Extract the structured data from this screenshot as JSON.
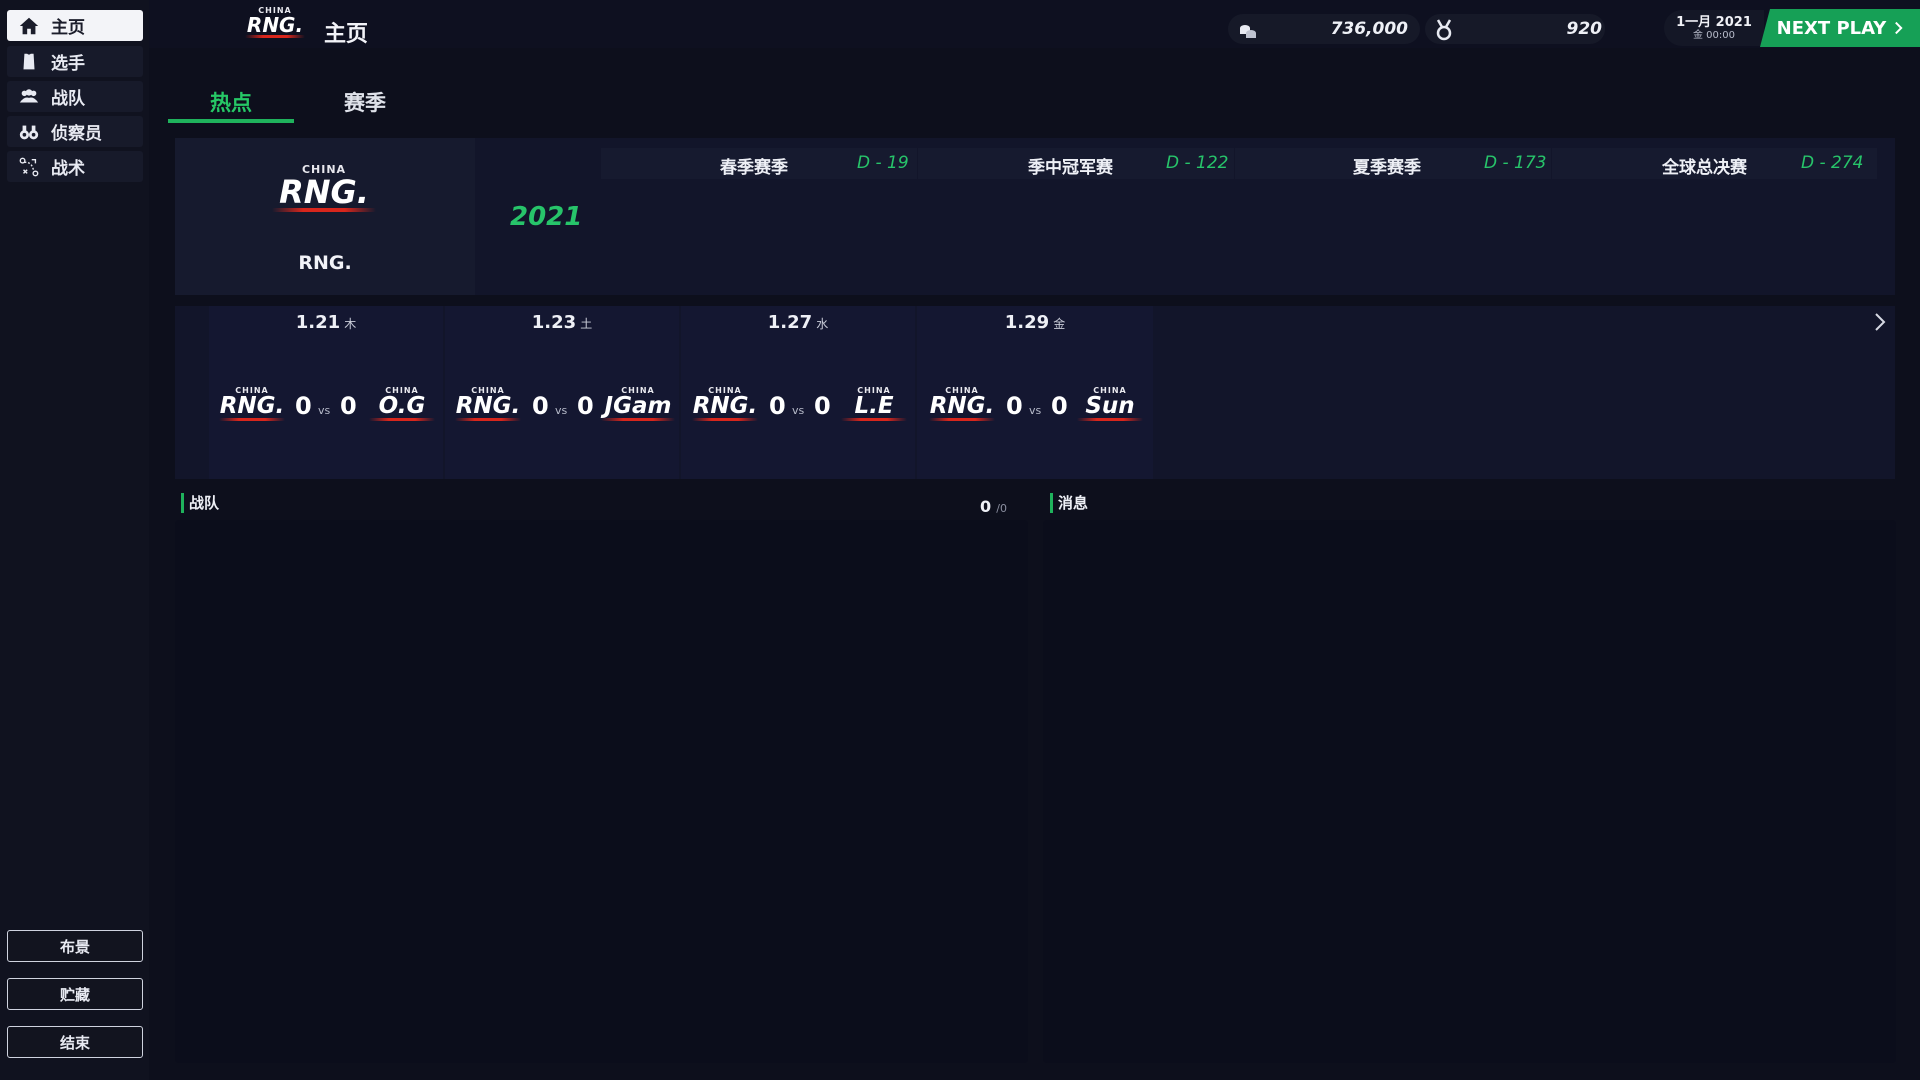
{
  "sidebar": {
    "items": [
      {
        "label": "主页",
        "icon": "home-icon",
        "active": true
      },
      {
        "label": "选手",
        "icon": "player-icon",
        "active": false
      },
      {
        "label": "战队",
        "icon": "team-icon",
        "active": false
      },
      {
        "label": "侦察员",
        "icon": "binoculars-icon",
        "active": false
      },
      {
        "label": "战术",
        "icon": "tactics-icon",
        "active": false
      }
    ],
    "bottom_buttons": [
      "布景",
      "贮藏",
      "结束"
    ]
  },
  "header": {
    "logo_small_text": "CHINA",
    "logo_team": "RNG.",
    "title": "主页",
    "money": "736,000",
    "points": "920",
    "date_main": "1一月 2021",
    "date_sub": "金 00:00",
    "next_play": "NEXT PLAY"
  },
  "tabs": [
    {
      "label": "热点",
      "active": true
    },
    {
      "label": "赛季",
      "active": false
    }
  ],
  "team_card": {
    "logo_small": "CHINA",
    "logo_name": "RNG.",
    "name": "RNG."
  },
  "season": {
    "year": "2021",
    "events": [
      {
        "name": "春季赛季",
        "countdown": "D - 19"
      },
      {
        "name": "季中冠军赛",
        "countdown": "D - 122"
      },
      {
        "name": "夏季赛季",
        "countdown": "D - 173"
      },
      {
        "name": "全球总决赛",
        "countdown": "D - 274"
      }
    ]
  },
  "matches": [
    {
      "date": "1.21",
      "day": "木",
      "home": "RNG.",
      "away": "O.G",
      "home_score": "0",
      "away_score": "0",
      "vs": "vs",
      "home_china": "CHINA",
      "away_china": "CHINA"
    },
    {
      "date": "1.23",
      "day": "土",
      "home": "RNG.",
      "away": "JGam",
      "home_score": "0",
      "away_score": "0",
      "vs": "vs",
      "home_china": "CHINA",
      "away_china": "CHINA"
    },
    {
      "date": "1.27",
      "day": "水",
      "home": "RNG.",
      "away": "L.E",
      "home_score": "0",
      "away_score": "0",
      "vs": "vs",
      "home_china": "CHINA",
      "away_china": "CHINA"
    },
    {
      "date": "1.29",
      "day": "金",
      "home": "RNG.",
      "away": "Sun",
      "home_score": "0",
      "away_score": "0",
      "vs": "vs",
      "home_china": "CHINA",
      "away_china": "CHINA"
    }
  ],
  "team_section": {
    "label": "战队",
    "count": "0",
    "total": "/0"
  },
  "message_section": {
    "label": "消息"
  },
  "colors": {
    "accent": "#1fb25c",
    "brand_red": "#d8261c"
  }
}
